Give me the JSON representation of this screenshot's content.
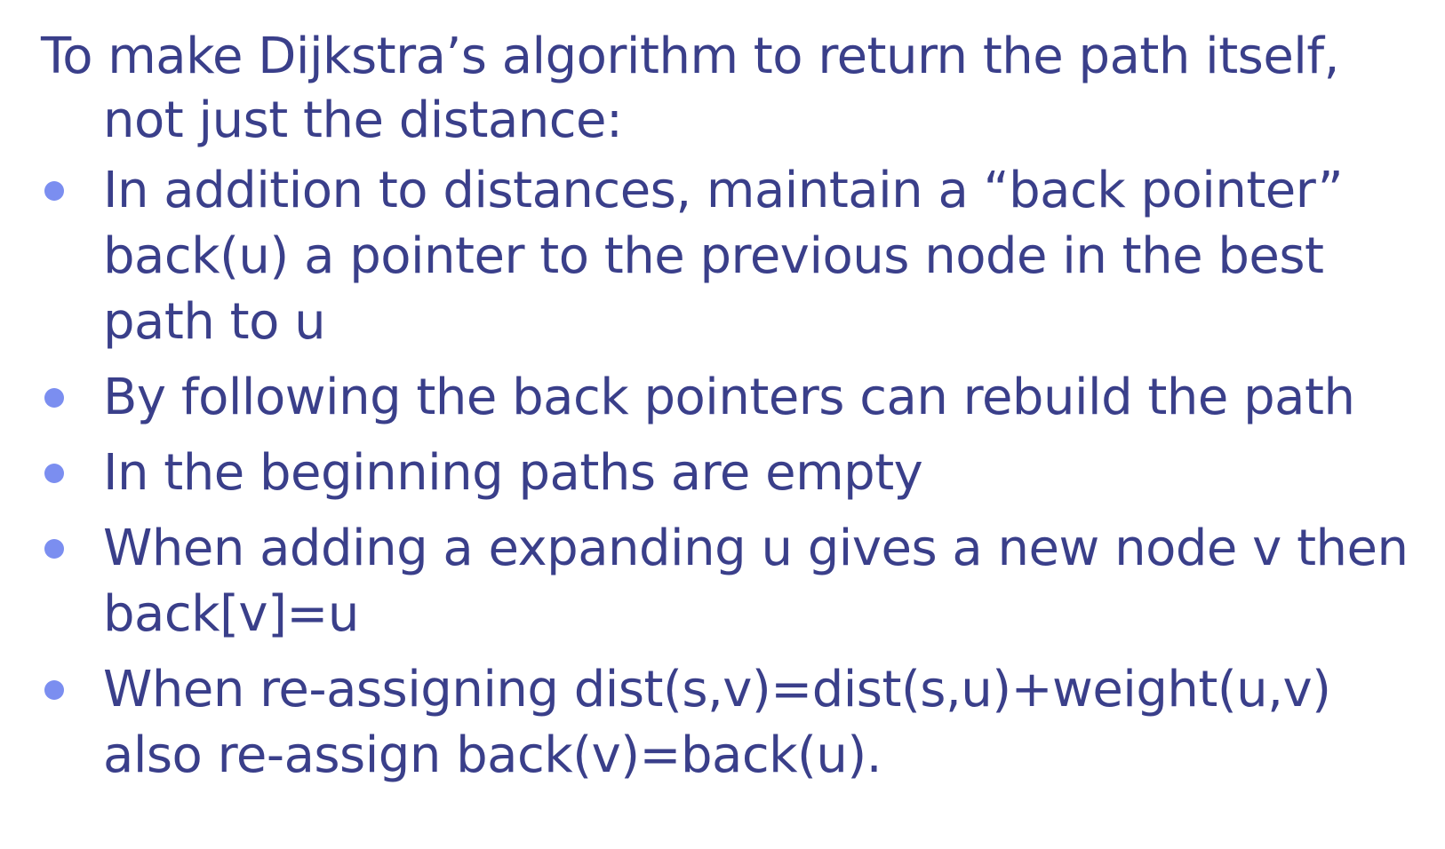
{
  "slide": {
    "intro": "To make Dijkstra’s algorithm to return the path itself, not just the distance:",
    "bullets": [
      "In addition to distances, maintain a “back pointer” back(u) a pointer to the previous node in the best path to u",
      "By following the back pointers can rebuild the path",
      "In the beginning paths are empty",
      "When adding a expanding u gives a new node v then back[v]=u",
      "When re-assigning dist(s,v)=dist(s,u)+weight(u,v) also re-assign back(v)=back(u)."
    ]
  },
  "colors": {
    "text": "#3a3f8a",
    "bullet": "#7b8ef0",
    "background": "#ffffff"
  },
  "icons": {
    "bullet": "bullet-dot-icon"
  }
}
